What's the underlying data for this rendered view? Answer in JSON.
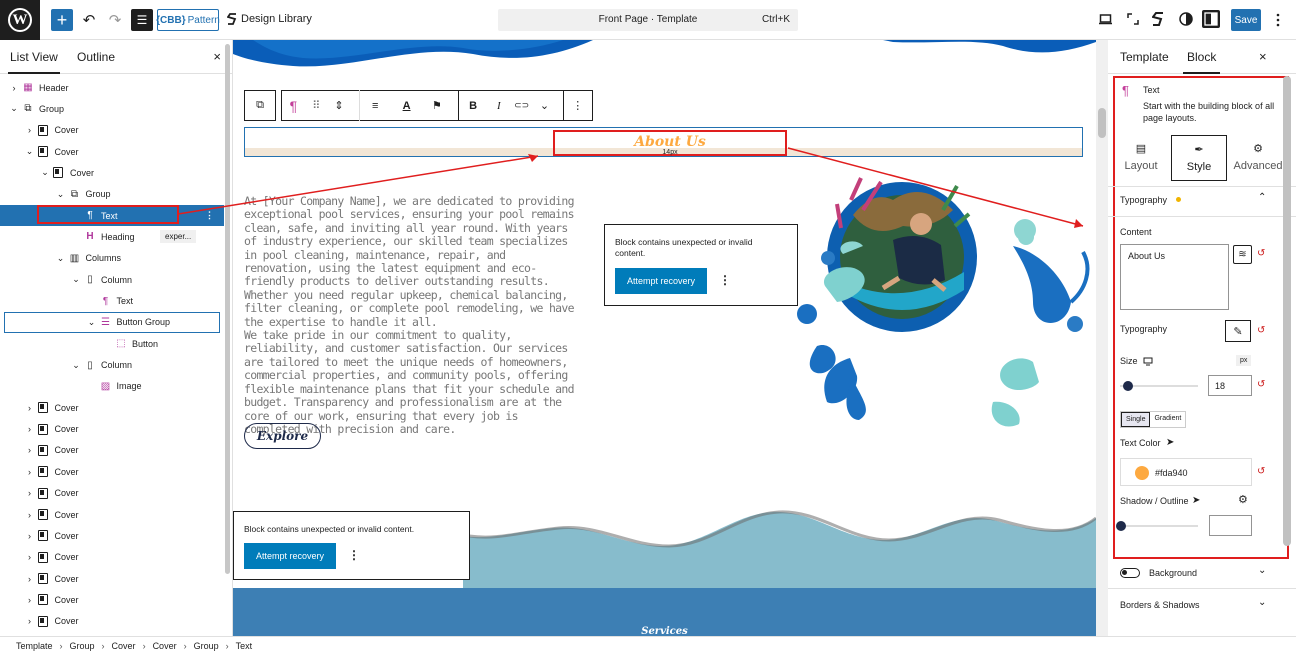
{
  "topbar": {
    "logo_glyph": "W",
    "add_glyph": "+",
    "undo_glyph": "↶",
    "redo_glyph": "↷",
    "tools_glyph": "☰",
    "cbb_prefix": "{CBB}",
    "cbb_label": "Pattern",
    "design_library": "Design Library",
    "command_title": "Front Page · Template",
    "command_shortcut": "Ctrl+K",
    "save": "Save"
  },
  "listview": {
    "tabs": [
      "List View",
      "Outline"
    ],
    "close_glyph": "×",
    "expand_glyph": "›",
    "collapse_glyph": "⌄",
    "items": [
      {
        "label": "Header",
        "depth": 0,
        "expanded": false,
        "icon": "header"
      },
      {
        "label": "Group",
        "depth": 0,
        "expanded": true,
        "icon": "group"
      },
      {
        "label": "Cover",
        "depth": 1,
        "expanded": false,
        "icon": "cover"
      },
      {
        "label": "Cover",
        "depth": 1,
        "expanded": true,
        "icon": "cover"
      },
      {
        "label": "Cover",
        "depth": 2,
        "expanded": true,
        "icon": "cover"
      },
      {
        "label": "Group",
        "depth": 3,
        "expanded": true,
        "icon": "group"
      },
      {
        "label": "Text",
        "depth": 4,
        "expanded": null,
        "icon": "paragraph",
        "selected": true
      },
      {
        "label": "Heading",
        "depth": 4,
        "expanded": null,
        "icon": "heading",
        "badge": "exper..."
      },
      {
        "label": "Columns",
        "depth": 3,
        "expanded": true,
        "icon": "columns"
      },
      {
        "label": "Column",
        "depth": 4,
        "expanded": true,
        "icon": "column"
      },
      {
        "label": "Text",
        "depth": 5,
        "expanded": null,
        "icon": "paragraph"
      },
      {
        "label": "Button Group",
        "depth": 5,
        "expanded": true,
        "icon": "buttons",
        "outlined": true
      },
      {
        "label": "Button",
        "depth": 6,
        "expanded": null,
        "icon": "button"
      },
      {
        "label": "Column",
        "depth": 4,
        "expanded": true,
        "icon": "column"
      },
      {
        "label": "Image",
        "depth": 5,
        "expanded": null,
        "icon": "image"
      },
      {
        "label": "Cover",
        "depth": 1,
        "expanded": false,
        "icon": "cover"
      },
      {
        "label": "Cover",
        "depth": 1,
        "expanded": false,
        "icon": "cover"
      },
      {
        "label": "Cover",
        "depth": 1,
        "expanded": false,
        "icon": "cover"
      },
      {
        "label": "Cover",
        "depth": 1,
        "expanded": false,
        "icon": "cover"
      },
      {
        "label": "Cover",
        "depth": 1,
        "expanded": false,
        "icon": "cover"
      },
      {
        "label": "Cover",
        "depth": 1,
        "expanded": false,
        "icon": "cover"
      },
      {
        "label": "Cover",
        "depth": 1,
        "expanded": false,
        "icon": "cover"
      },
      {
        "label": "Cover",
        "depth": 1,
        "expanded": false,
        "icon": "cover"
      },
      {
        "label": "Cover",
        "depth": 1,
        "expanded": false,
        "icon": "cover"
      },
      {
        "label": "Cover",
        "depth": 1,
        "expanded": false,
        "icon": "cover"
      },
      {
        "label": "Cover",
        "depth": 1,
        "expanded": false,
        "icon": "cover"
      },
      {
        "label": "Cover",
        "depth": 1,
        "expanded": false,
        "icon": "cover"
      }
    ]
  },
  "canvas": {
    "toolbar_glyphs": [
      "⧉",
      "¶",
      "⠿",
      "⇕",
      "≡",
      "A",
      "⚑",
      "B",
      "I",
      "⊂⊃",
      "⌄",
      "⋮"
    ],
    "about_title": "About Us",
    "about_px": "14px",
    "paragraph_1": "At [Your Company Name], we are dedicated to providing exceptional pool services, ensuring your pool remains clean, safe, and inviting all year round. With years of industry experience, our skilled team specializes in pool cleaning, maintenance, repair, and renovation, using the latest equipment and eco-friendly products to deliver outstanding results. Whether you need regular upkeep, chemical balancing, filter cleaning, or complete pool remodeling, we have the expertise to handle it all.",
    "paragraph_2": "We take pride in our commitment to quality, reliability, and customer satisfaction. Our services are tailored to meet the unique needs of homeowners, commercial properties, and community pools, offering flexible maintenance plans that fit your schedule and budget. Transparency and professionalism are at the core of our work, ensuring that every job is completed with precision and care.",
    "explore_button": "Explore",
    "warning_1": {
      "message": "Block contains unexpected or invalid content.",
      "button": "Attempt recovery"
    },
    "warning_2": {
      "message": "Block contains unexpected or invalid content.",
      "button": "Attempt recovery"
    },
    "more_glyph": "⋮",
    "services_title": "Services"
  },
  "panel": {
    "tabs": [
      "Template",
      "Block"
    ],
    "close_glyph": "×",
    "block_icon": "¶",
    "block_name": "Text",
    "block_description": "Start with the building block of all page layouts.",
    "subtabs": [
      {
        "label": "Layout",
        "icon": "▤"
      },
      {
        "label": "Style",
        "icon": "✒"
      },
      {
        "label": "Advanced",
        "icon": "⚙"
      }
    ],
    "typography_section": "Typography",
    "content_label": "Content",
    "content_value": "About Us",
    "typography_label": "Typography",
    "size_label": "Size",
    "size_unit": "px",
    "size_value": "18",
    "size_fraction": 0.05,
    "color_mode_tabs": [
      "Single",
      "Gradient"
    ],
    "text_color_label": "Text Color",
    "text_color_value": "#fda940",
    "shadow_label": "Shadow / Outline",
    "shadow_fraction": 0.0,
    "background_label": "Background",
    "borders_label": "Borders & Shadows",
    "reset_glyph": "↺",
    "chevron_up": "⌃",
    "chevron_down": "⌄"
  },
  "footer": {
    "breadcrumbs": [
      "Template",
      "Group",
      "Cover",
      "Cover",
      "Group",
      "Text"
    ],
    "separator": "›"
  },
  "colors": {
    "accent": "#2271b1",
    "annotation": "#e01e1e",
    "text_color": "#fda940",
    "wave_dark": "#0a5db8",
    "wave_light": "#87bccc"
  }
}
